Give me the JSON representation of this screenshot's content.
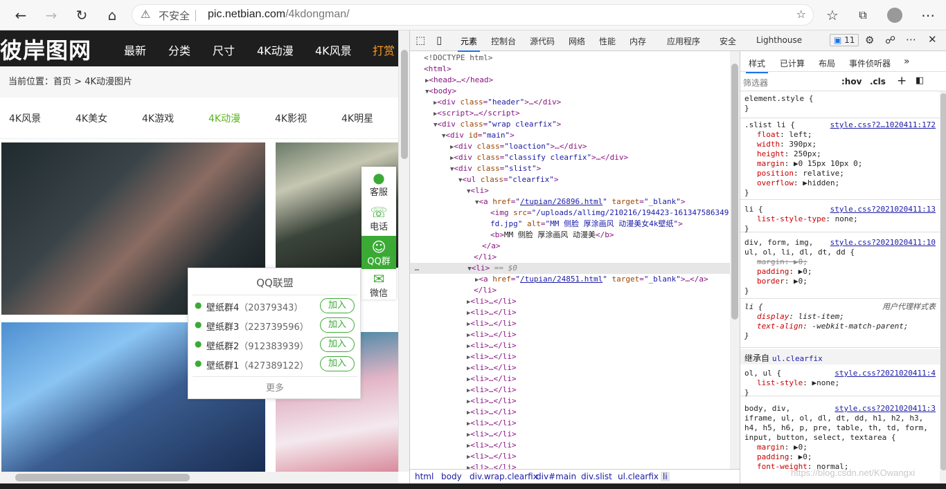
{
  "browser": {
    "security_label": "不安全",
    "url_host": "pic.netbian.com",
    "url_path": "/4kdongman/"
  },
  "site": {
    "logo": "彼岸图网",
    "nav": [
      "最新",
      "分类",
      "尺寸",
      "4K动漫",
      "4K风景",
      "打赏"
    ],
    "breadcrumb_prefix": "当前位置：",
    "breadcrumb_home": "首页",
    "breadcrumb_sep": ">",
    "breadcrumb_current": "4K动漫图片",
    "categories": [
      "4K风景",
      "4K美女",
      "4K游戏",
      "4K动漫",
      "4K影视",
      "4K明星"
    ],
    "sidebar": [
      {
        "label": "客服",
        "icon": "qq-penguin-icon"
      },
      {
        "label": "电话",
        "icon": "phone-icon"
      },
      {
        "label": "QQ群",
        "icon": "qq-group-icon"
      },
      {
        "label": "微信",
        "icon": "wechat-icon"
      }
    ],
    "qq_popup": {
      "title": "QQ联盟",
      "groups": [
        {
          "name": "壁纸群4",
          "number": "（20379343）",
          "action": "加入"
        },
        {
          "name": "壁纸群3",
          "number": "（223739596）",
          "action": "加入"
        },
        {
          "name": "壁纸群2",
          "number": "（912383939）",
          "action": "加入"
        },
        {
          "name": "壁纸群1",
          "number": "（427389122）",
          "action": "加入"
        }
      ],
      "more": "更多"
    }
  },
  "devtools": {
    "tabs": [
      "元素",
      "控制台",
      "源代码",
      "网络",
      "性能",
      "内存",
      "应用程序",
      "安全",
      "Lighthouse"
    ],
    "issues_count": "11",
    "breadcrumbs": [
      "html",
      "body",
      "div.wrap.clearfix",
      "div#main",
      "div.slist",
      "ul.clearfix",
      "li"
    ],
    "style_tabs": [
      "样式",
      "已计算",
      "布局",
      "事件侦听器"
    ],
    "filter_placeholder": "筛选器",
    "hov": ":hov",
    "cls": ".cls",
    "inherited_label": "继承自",
    "inherited_from": "ul.clearfix",
    "ua_label": "用户代理样式表"
  },
  "watermark": "https://blog.csdn.net/KOwangxi"
}
